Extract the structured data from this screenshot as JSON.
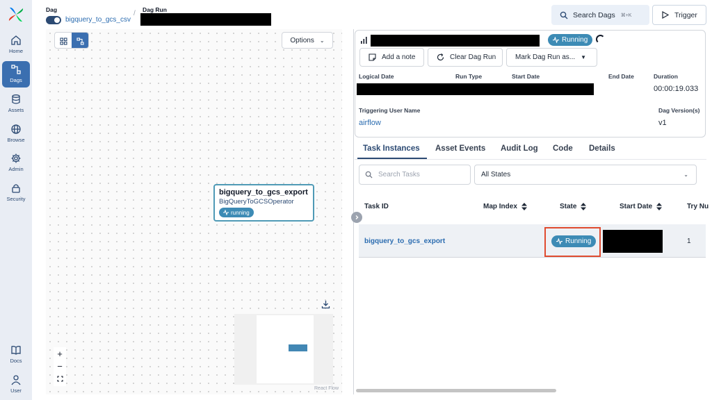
{
  "sidebar": {
    "items": [
      {
        "label": "Home",
        "icon": "home-icon"
      },
      {
        "label": "Dags",
        "icon": "dags-icon",
        "active": true
      },
      {
        "label": "Assets",
        "icon": "database-icon"
      },
      {
        "label": "Browse",
        "icon": "globe-icon"
      },
      {
        "label": "Admin",
        "icon": "gear-icon"
      },
      {
        "label": "Security",
        "icon": "lock-icon"
      }
    ],
    "bottom_items": [
      {
        "label": "Docs",
        "icon": "book-icon"
      },
      {
        "label": "User",
        "icon": "user-icon"
      }
    ]
  },
  "header": {
    "dag_label": "Dag",
    "dag_id": "bigquery_to_gcs_csv",
    "separator": "/",
    "dag_run_label": "Dag Run",
    "search_label": "Search Dags",
    "search_shortcut": "⌘+K",
    "trigger_label": "Trigger"
  },
  "graph": {
    "options_label": "Options",
    "node": {
      "task_id": "bigquery_to_gcs_export",
      "operator": "BigQueryToGCSOperator",
      "state": "running"
    },
    "attribution": "React Flow"
  },
  "run": {
    "state": "Running",
    "actions": {
      "add_note": "Add a note",
      "clear": "Clear Dag Run",
      "mark": "Mark Dag Run as..."
    },
    "labels": {
      "logical_date": "Logical Date",
      "run_type": "Run Type",
      "start_date": "Start Date",
      "end_date": "End Date",
      "duration": "Duration",
      "triggering_user": "Triggering User Name",
      "dag_version": "Dag Version(s)"
    },
    "values": {
      "duration": "00:00:19.033",
      "triggering_user": "airflow",
      "dag_version": "v1"
    }
  },
  "tabs": [
    "Task Instances",
    "Asset Events",
    "Audit Log",
    "Code",
    "Details"
  ],
  "filters": {
    "search_placeholder": "Search Tasks",
    "state_selected": "All States"
  },
  "table": {
    "columns": [
      "Task ID",
      "Map Index",
      "State",
      "Start Date",
      "Try Nu"
    ],
    "rows": [
      {
        "task_id": "bigquery_to_gcs_export",
        "state": "Running",
        "try_number": "1"
      }
    ]
  },
  "colors": {
    "accent": "#2c4a73",
    "running": "#3d8bb5",
    "highlight": "#e04b2f"
  }
}
